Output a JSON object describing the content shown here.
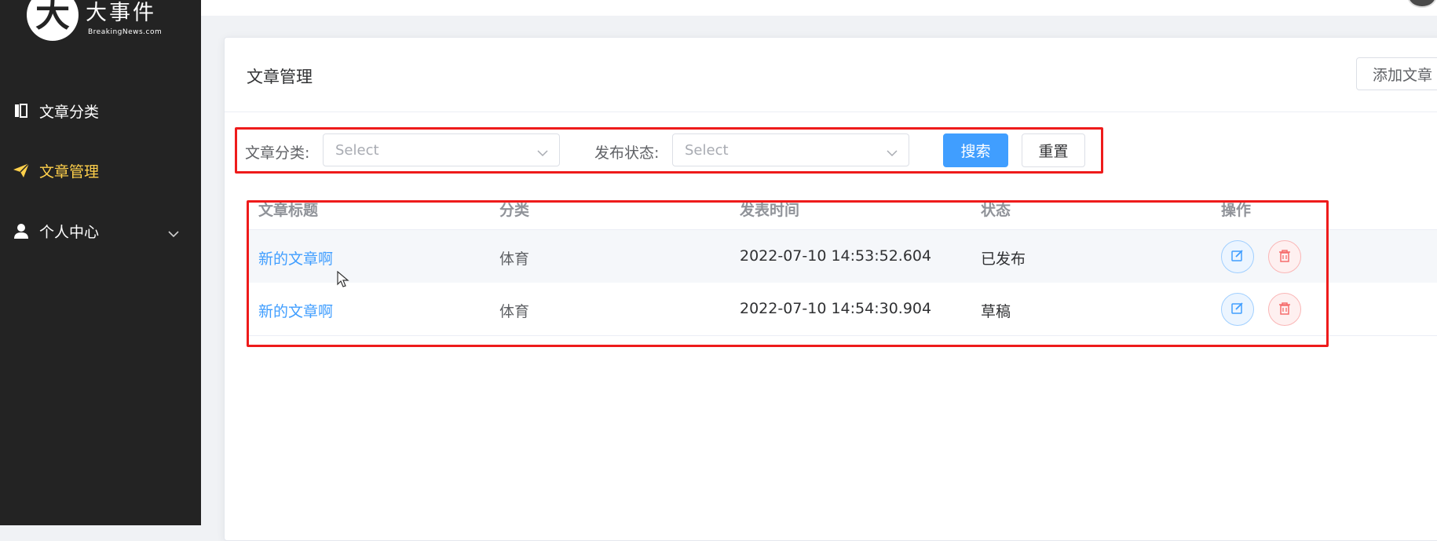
{
  "app": {
    "logo_mark": "大",
    "logo_title": "大事件",
    "logo_sub": "BreakingNews.com"
  },
  "sidebar": {
    "items": [
      {
        "label": "文章分类",
        "icon": "book-icon",
        "active": false
      },
      {
        "label": "文章管理",
        "icon": "send-icon",
        "active": true
      },
      {
        "label": "个人中心",
        "icon": "user-icon",
        "active": false,
        "expandable": true
      }
    ]
  },
  "colors": {
    "sidebar_bg": "#232323",
    "active_menu": "#ffd04b",
    "primary": "#409eff",
    "danger": "#f56c6c",
    "highlight_border": "#ee1b1b"
  },
  "card": {
    "title": "文章管理",
    "add_button": "添加文章"
  },
  "filter": {
    "category_label": "文章分类:",
    "category_placeholder": "Select",
    "status_label": "发布状态:",
    "status_placeholder": "Select",
    "search_button": "搜索",
    "reset_button": "重置"
  },
  "table": {
    "columns": [
      "文章标题",
      "分类",
      "发表时间",
      "状态",
      "操作"
    ],
    "rows": [
      {
        "title": "新的文章啊",
        "category": "体育",
        "time": "2022-07-10 14:53:52.604",
        "state": "已发布"
      },
      {
        "title": "新的文章啊",
        "category": "体育",
        "time": "2022-07-10 14:54:30.904",
        "state": "草稿"
      }
    ]
  }
}
